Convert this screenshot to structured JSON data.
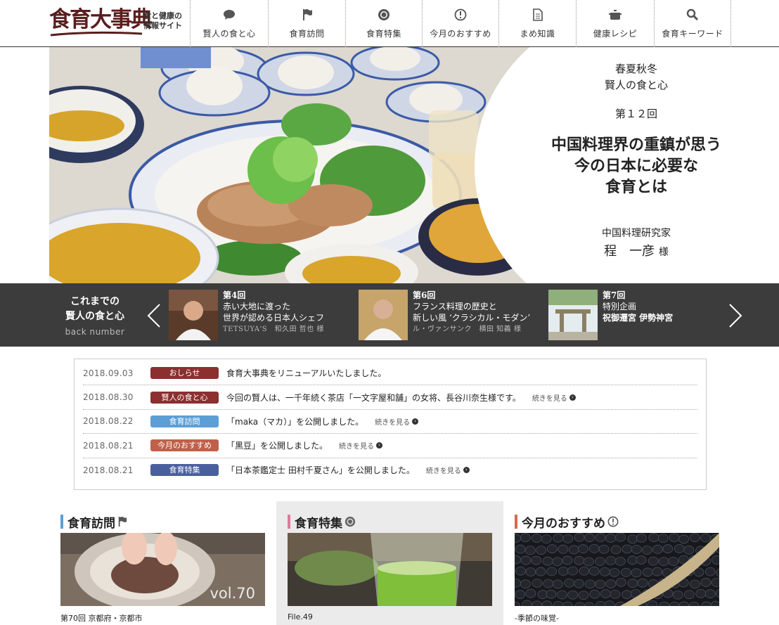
{
  "header": {
    "logo_text": "食育大事典",
    "logo_sub": "食と健康の情報サイト",
    "nav": [
      {
        "label": "賢人の食と心",
        "icon": "speech-bubble-icon"
      },
      {
        "label": "食育訪問",
        "icon": "flag-icon"
      },
      {
        "label": "食育特集",
        "icon": "sun-badge-icon"
      },
      {
        "label": "今月のおすすめ",
        "icon": "exclamation-circle-icon"
      },
      {
        "label": "まめ知識",
        "icon": "document-icon"
      },
      {
        "label": "健康レシピ",
        "icon": "cooking-pot-icon"
      },
      {
        "label": "食育キーワード",
        "icon": "search-icon"
      }
    ]
  },
  "hero": {
    "series_line1": "春夏秋冬",
    "series_line2": "賢人の食と心",
    "issue": "第１２回",
    "title_line1": "中国料理界の重鎮が思う",
    "title_line2": "今の日本に必要な",
    "title_line3": "食育とは",
    "role": "中国料理研究家",
    "name": "程　一彦",
    "honorific": "様"
  },
  "back_number": {
    "heading_line1": "これまでの",
    "heading_line2": "賢人の食と心",
    "sub": "back number",
    "items": [
      {
        "issue": "第4回",
        "line1": "赤い大地に渡った",
        "line2": "世界が認める日本人シェフ",
        "author": "TETSUYA'S　和久田 哲也 様"
      },
      {
        "issue": "第6回",
        "line1": "フランス料理の歴史と",
        "line2": "新しい風 ‘クラシカル・モダン’",
        "author": "ル・ヴァンサンク　横田 知義 様"
      },
      {
        "issue": "第7回",
        "line1": "特別企画",
        "line2": "祝御遷宮 伊勢神宮",
        "author": ""
      }
    ]
  },
  "news": {
    "more_label": "続きを見る",
    "items": [
      {
        "date": "2018.09.03",
        "badge": "おしらせ",
        "badge_color": "#8b2f2f",
        "text": "食育大事典をリニューアルいたしました。",
        "more": false
      },
      {
        "date": "2018.08.30",
        "badge": "賢人の食と心",
        "badge_color": "#8b2f2f",
        "text": "今回の賢人は、一千年続く茶店「一文字屋和舗」の女将、長谷川奈生様です。",
        "more": true
      },
      {
        "date": "2018.08.22",
        "badge": "食育訪問",
        "badge_color": "#5b9fd6",
        "text": "「maka（マカ）」を公開しました。",
        "more": true
      },
      {
        "date": "2018.08.21",
        "badge": "今月のおすすめ",
        "badge_color": "#c0604a",
        "text": "「黒豆」を公開しました。",
        "more": true
      },
      {
        "date": "2018.08.21",
        "badge": "食育特集",
        "badge_color": "#4a5f9e",
        "text": "「日本茶鑑定士 田村千夏さん」を公開しました。",
        "more": true
      }
    ]
  },
  "cards": [
    {
      "title": "食育訪問",
      "icon": "flag-icon",
      "accent": "#5aa0d8",
      "caption": "第70回 京都府・京都市",
      "overlay": "vol.70"
    },
    {
      "title": "食育特集",
      "icon": "sun-badge-icon",
      "accent": "#e07a9a",
      "caption": "File.49",
      "overlay": ""
    },
    {
      "title": "今月のおすすめ",
      "icon": "exclamation-circle-icon",
      "accent": "#d46b4e",
      "caption": "-季節の味覚-",
      "overlay": ""
    }
  ]
}
